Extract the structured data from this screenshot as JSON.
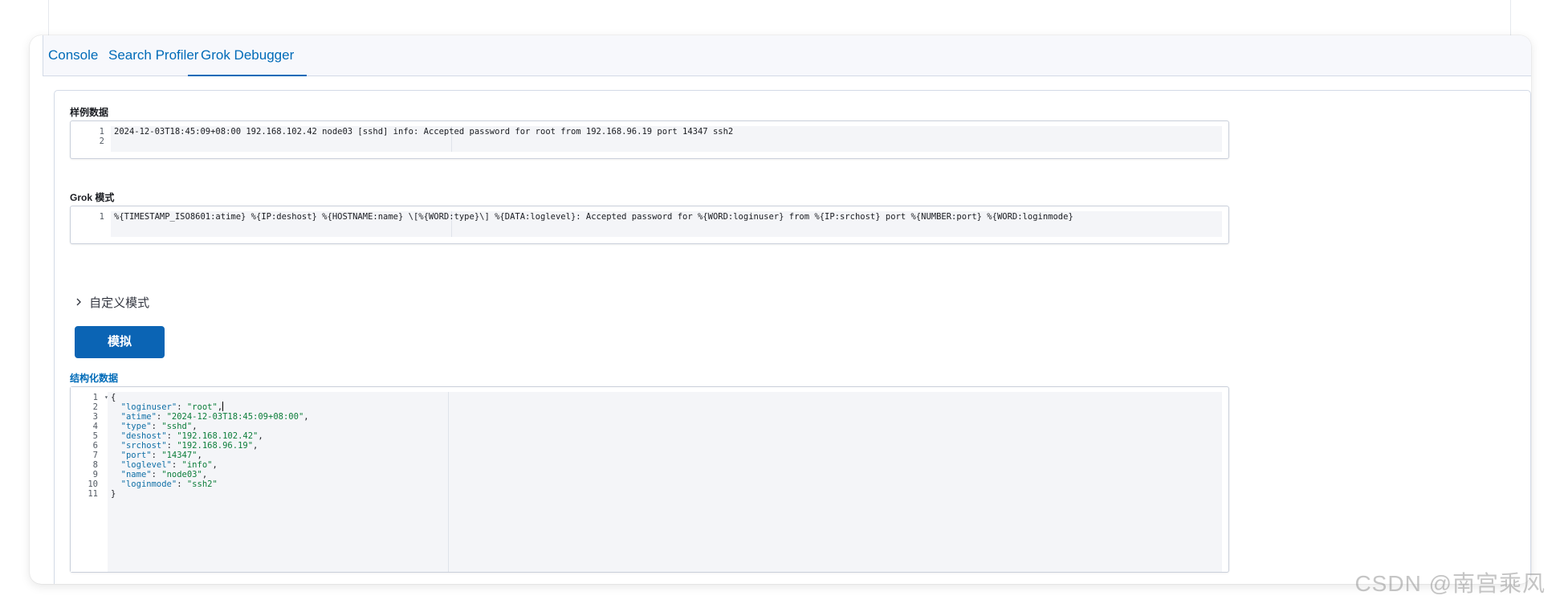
{
  "tabs": [
    {
      "label": "Console"
    },
    {
      "label": "Search Profiler"
    },
    {
      "label": "Grok Debugger"
    }
  ],
  "active_tab": "Grok Debugger",
  "sample_data": {
    "label": "样例数据",
    "line_numbers": [
      "1",
      "2"
    ],
    "lines": [
      "2024-12-03T18:45:09+08:00 192.168.102.42 node03 [sshd] info: Accepted password for root from 192.168.96.19 port 14347 ssh2",
      ""
    ]
  },
  "grok_pattern": {
    "label": "Grok 模式",
    "line_numbers": [
      "1"
    ],
    "lines": [
      "%{TIMESTAMP_ISO8601:atime} %{IP:deshost} %{HOSTNAME:name} \\[%{WORD:type}\\] %{DATA:loglevel}: Accepted password for %{WORD:loginuser} from %{IP:srchost} port %{NUMBER:port} %{WORD:loginmode}"
    ]
  },
  "custom_patterns": {
    "label": "自定义模式"
  },
  "simulate_button": {
    "label": "模拟"
  },
  "structured_data": {
    "label": "结构化数据",
    "line_numbers": [
      "1",
      "2",
      "3",
      "4",
      "5",
      "6",
      "7",
      "8",
      "9",
      "10",
      "11"
    ],
    "open_brace": "{",
    "close_brace": "}",
    "fields": [
      {
        "key": "\"loginuser\"",
        "value": "\"root\""
      },
      {
        "key": "\"atime\"",
        "value": "\"2024-12-03T18:45:09+08:00\""
      },
      {
        "key": "\"type\"",
        "value": "\"sshd\""
      },
      {
        "key": "\"deshost\"",
        "value": "\"192.168.102.42\""
      },
      {
        "key": "\"srchost\"",
        "value": "\"192.168.96.19\""
      },
      {
        "key": "\"port\"",
        "value": "\"14347\""
      },
      {
        "key": "\"loglevel\"",
        "value": "\"info\""
      },
      {
        "key": "\"name\"",
        "value": "\"node03\""
      },
      {
        "key": "\"loginmode\"",
        "value": "\"ssh2\""
      }
    ]
  },
  "icons": {
    "chevron": "chevron-right-icon",
    "fold": "fold-arrow-icon"
  },
  "colors": {
    "accent": "#006bb8",
    "button": "#0b64b4",
    "json_key": "#0f6fa6",
    "json_string": "#0c7d3a"
  },
  "watermark": "CSDN @南宫乘风"
}
